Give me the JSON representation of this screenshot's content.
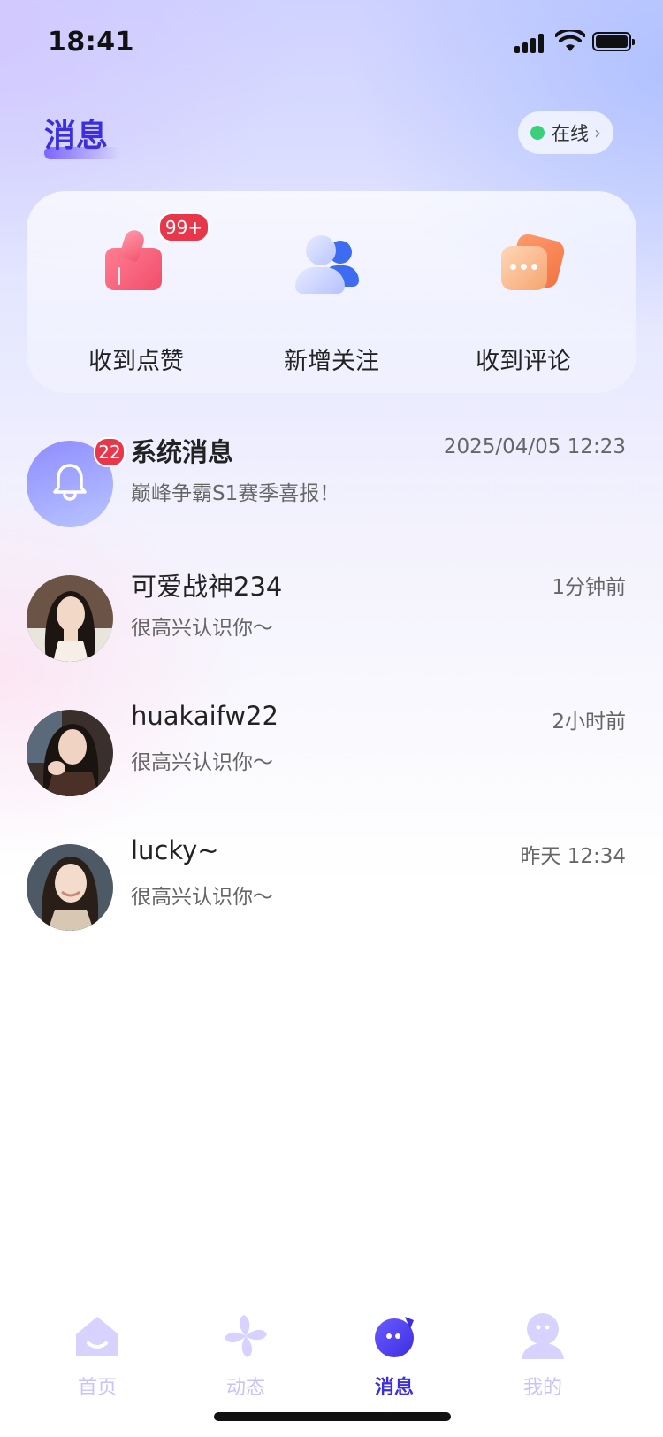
{
  "status_bar": {
    "time": "18:41"
  },
  "header": {
    "title": "消息",
    "status_label": "在线",
    "status_color": "#3ad07a"
  },
  "quick_actions": [
    {
      "label": "收到点赞",
      "icon": "thumbs-up-icon",
      "badge": "99+"
    },
    {
      "label": "新增关注",
      "icon": "users-icon"
    },
    {
      "label": "收到评论",
      "icon": "comment-icon"
    }
  ],
  "messages": [
    {
      "name": "系统消息",
      "time": "2025/04/05 12:23",
      "preview": "巅峰争霸S1赛季喜报！",
      "unread": "22",
      "icon": "bell-icon"
    },
    {
      "name": "可爱战神234",
      "time": "1分钟前",
      "preview": "很高兴认识你～"
    },
    {
      "name": "huakaifw22",
      "time": "2小时前",
      "preview": "很高兴认识你～"
    },
    {
      "name": "lucky~",
      "time": "昨天 12:34",
      "preview": "很高兴认识你～"
    }
  ],
  "tabbar": {
    "items": [
      {
        "label": "首页",
        "icon": "home-icon"
      },
      {
        "label": "动态",
        "icon": "pinwheel-icon"
      },
      {
        "label": "消息",
        "icon": "message-icon",
        "active": true
      },
      {
        "label": "我的",
        "icon": "profile-icon"
      }
    ]
  },
  "colors": {
    "accent": "#3b2ee0",
    "badge": "#e8374b",
    "inactive_tab": "#c8c3ff"
  }
}
